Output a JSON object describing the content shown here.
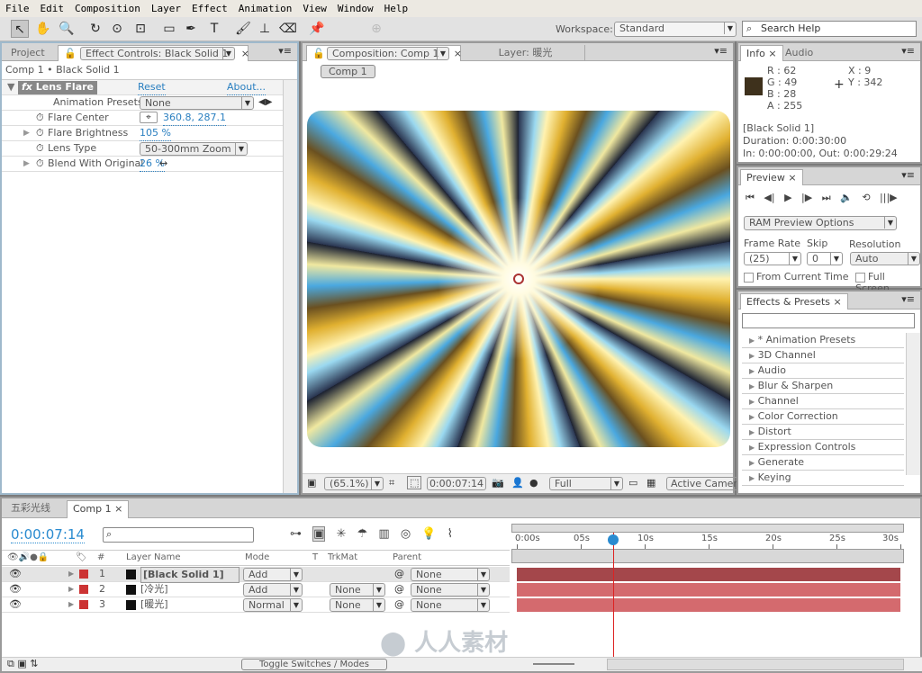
{
  "menu": [
    "File",
    "Edit",
    "Composition",
    "Layer",
    "Effect",
    "Animation",
    "View",
    "Window",
    "Help"
  ],
  "toolbar": {
    "workspace_label": "Workspace:",
    "workspace": "Standard",
    "search_placeholder": "Search Help"
  },
  "effect_panel": {
    "tab_project": "Project",
    "tab_effect": "Effect Controls: Black Solid 1",
    "breadcrumb": "Comp 1 • Black Solid 1",
    "effect_name": "Lens Flare",
    "reset": "Reset",
    "about": "About...",
    "presets_label": "Animation Presets:",
    "presets_value": "None",
    "props": [
      {
        "label": "Flare Center",
        "value": "360.8, 287.1"
      },
      {
        "label": "Flare Brightness",
        "value": "105 %"
      },
      {
        "label": "Lens Type",
        "value": "50-300mm Zoom"
      },
      {
        "label": "Blend With Original",
        "value": "26 %"
      }
    ]
  },
  "comp_panel": {
    "tab_comp": "Composition: Comp 1",
    "tab_layer": "Layer: 暖光",
    "comp_button": "Comp 1",
    "zoom": "(65.1%)",
    "timecode": "0:00:07:14",
    "resolution": "Full",
    "camera": "Active Camera"
  },
  "info": {
    "tab": "Info",
    "tab_audio": "Audio",
    "r": "R : 62",
    "g": "G : 49",
    "b": "B : 28",
    "a": "A : 255",
    "x": "X : 9",
    "y": "Y : 342",
    "swatch": "#3e311c",
    "layer": "[Black Solid 1]",
    "duration": "Duration: 0:00:30:00",
    "inout": "In: 0:00:00:00, Out: 0:00:29:24"
  },
  "preview": {
    "tab": "Preview",
    "ram": "RAM Preview Options",
    "frame_rate_label": "Frame Rate",
    "skip_label": "Skip",
    "resolution_label": "Resolution",
    "frame_rate": "(25)",
    "skip": "0",
    "resolution": "Auto",
    "from_current": "From Current Time",
    "full_screen": "Full Screen"
  },
  "effects": {
    "tab": "Effects & Presets",
    "items": [
      "* Animation Presets",
      "3D Channel",
      "Audio",
      "Blur & Sharpen",
      "Channel",
      "Color Correction",
      "Distort",
      "Expression Controls",
      "Generate",
      "Keying"
    ]
  },
  "timeline": {
    "tab1": "五彩光线",
    "tab2": "Comp 1",
    "timecode": "0:00:07:14",
    "cols": {
      "num": "#",
      "name": "Layer Name",
      "mode": "Mode",
      "t": "T",
      "trkmat": "TrkMat",
      "parent": "Parent"
    },
    "layers": [
      {
        "num": "1",
        "name": "[Black Solid 1]",
        "mode": "Add",
        "trkmat": "",
        "parent": "None"
      },
      {
        "num": "2",
        "name": "[冷光]",
        "mode": "Add",
        "trkmat": "None",
        "parent": "None"
      },
      {
        "num": "3",
        "name": "[暖光]",
        "mode": "Normal",
        "trkmat": "None",
        "parent": "None"
      }
    ],
    "ruler": [
      "0:00s",
      "05s",
      "10s",
      "15s",
      "20s",
      "25s",
      "30s"
    ],
    "toggle": "Toggle Switches / Modes",
    "current_time_s": 7.56,
    "duration_s": 30
  },
  "watermark": "人人素材"
}
